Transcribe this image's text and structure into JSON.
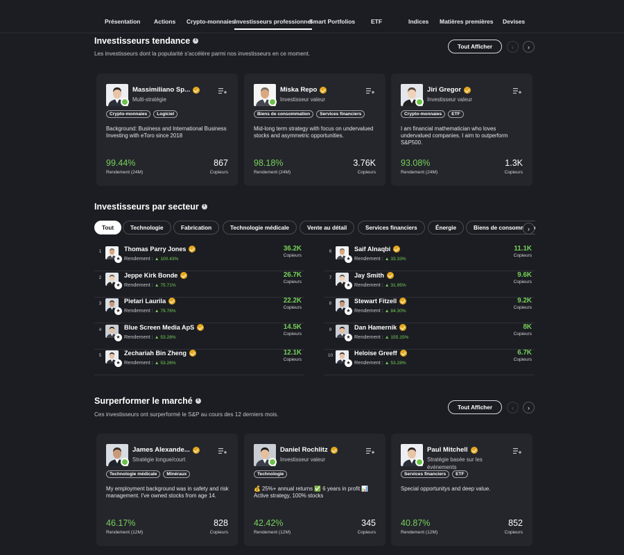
{
  "nav": {
    "tabs": [
      {
        "label": "Présentation",
        "active": false
      },
      {
        "label": "Actions",
        "active": false
      },
      {
        "label": "Crypto-monnaies",
        "active": false
      },
      {
        "label": "Investisseurs professionnel",
        "active": true
      },
      {
        "label": "Smart Portfolios",
        "active": false
      },
      {
        "label": "ETF",
        "active": false
      },
      {
        "label": "Indices",
        "active": false
      },
      {
        "label": "Matières premières",
        "active": false
      },
      {
        "label": "Devises",
        "active": false
      }
    ]
  },
  "trending": {
    "title": "Investisseurs tendance",
    "subtitle": "Les investisseurs dont la popularité s'accélère parmi nos investisseurs en ce moment.",
    "show_all": "Tout Afficher",
    "cards": [
      {
        "name": "Massimiliano Sp...",
        "role": "Multi-stratégie",
        "tags": [
          "Crypto-monnaies",
          "Logiciel"
        ],
        "bio": "Background: Business and International Business Investing with eToro since 2018",
        "return": "99.44%",
        "return_label": "Rendement (24M)",
        "copiers": "867",
        "copiers_label": "Copieurs"
      },
      {
        "name": "Miska Repo",
        "role": "Investisseur valeur",
        "tags": [
          "Biens de consommation",
          "Services financiers"
        ],
        "bio": "Mid-long term strategy with focus on undervalued stocks and asymmetric opportunities.",
        "return": "98.18%",
        "return_label": "Rendement (24M)",
        "copiers": "3.76K",
        "copiers_label": "Copieurs"
      },
      {
        "name": "Jiri Gregor",
        "role": "Investisseur valeur",
        "tags": [
          "Crypto-monnaies",
          "ETF"
        ],
        "bio": "I am financial mathematician who loves undervalued companies. I aim to outperform S&P500.",
        "return": "93.08%",
        "return_label": "Rendement (24M)",
        "copiers": "1.3K",
        "copiers_label": "Copieurs"
      }
    ]
  },
  "sector": {
    "title": "Investisseurs par secteur",
    "chips": [
      "Tout",
      "Technologie",
      "Fabrication",
      "Technologie médicale",
      "Vente au détail",
      "Services financiers",
      "Énergie",
      "Biens de consommation"
    ],
    "return_label": "Rendement :",
    "copiers_label": "Copieurs",
    "left": [
      {
        "rank": "1",
        "name": "Thomas Parry Jones",
        "return": "100.43%",
        "copiers": "36.2K"
      },
      {
        "rank": "2",
        "name": "Jeppe Kirk Bonde",
        "return": "75.71%",
        "copiers": "26.7K"
      },
      {
        "rank": "3",
        "name": "Pietari Laurila",
        "return": "79.76%",
        "copiers": "22.2K"
      },
      {
        "rank": "4",
        "name": "Blue Screen Media ApS",
        "return": "53.28%",
        "copiers": "14.5K"
      },
      {
        "rank": "5",
        "name": "Zechariah Bin Zheng",
        "return": "53.26%",
        "copiers": "12.1K"
      }
    ],
    "right": [
      {
        "rank": "6",
        "name": "Saif Alnaqbi",
        "return": "33.33%",
        "copiers": "11.1K"
      },
      {
        "rank": "7",
        "name": "Jay Smith",
        "return": "31.95%",
        "copiers": "9.6K"
      },
      {
        "rank": "8",
        "name": "Stewart Fitzell",
        "return": "84.30%",
        "copiers": "9.2K"
      },
      {
        "rank": "9",
        "name": "Dan Hamernik",
        "return": "155.15%",
        "copiers": "8K"
      },
      {
        "rank": "10",
        "name": "Heloise Greeff",
        "return": "53.28%",
        "copiers": "6.7K"
      }
    ]
  },
  "outperform": {
    "title": "Surperformer le marché",
    "subtitle": "Ces investisseurs ont surperformé le S&P au cours des 12 derniers mois.",
    "show_all": "Tout Afficher",
    "cards": [
      {
        "name": "James Alexande...",
        "role": "Stratégie longue/court",
        "tags": [
          "Technologie médicale",
          "Minéraux"
        ],
        "bio": "My employment background was in safety and risk management. I've owned stocks from age 14.",
        "return": "46.17%",
        "return_label": "Rendement (12M)",
        "copiers": "828",
        "copiers_label": "Copieurs"
      },
      {
        "name": "Daniel Rochlitz",
        "role": "Investisseur valeur",
        "tags": [
          "Technologie"
        ],
        "bio": "💰 25%+ annual returns ✅ 6 years in profit 📊 Active strategy, 100% stocks",
        "return": "42.42%",
        "return_label": "Rendement (12M)",
        "copiers": "345",
        "copiers_label": "Copieurs"
      },
      {
        "name": "Paul Mitchell",
        "role": "Stratégie basée sur les événements",
        "tags": [
          "Services financiers",
          "ETF"
        ],
        "bio": "Special opportunitys and deep value.",
        "return": "40.87%",
        "return_label": "Rendement (12M)",
        "copiers": "852",
        "copiers_label": "Copieurs"
      }
    ]
  },
  "colors": {
    "background": "#1c1d22",
    "card": "#25262c",
    "positive": "#76d15a",
    "verified": "#e3a91f"
  }
}
